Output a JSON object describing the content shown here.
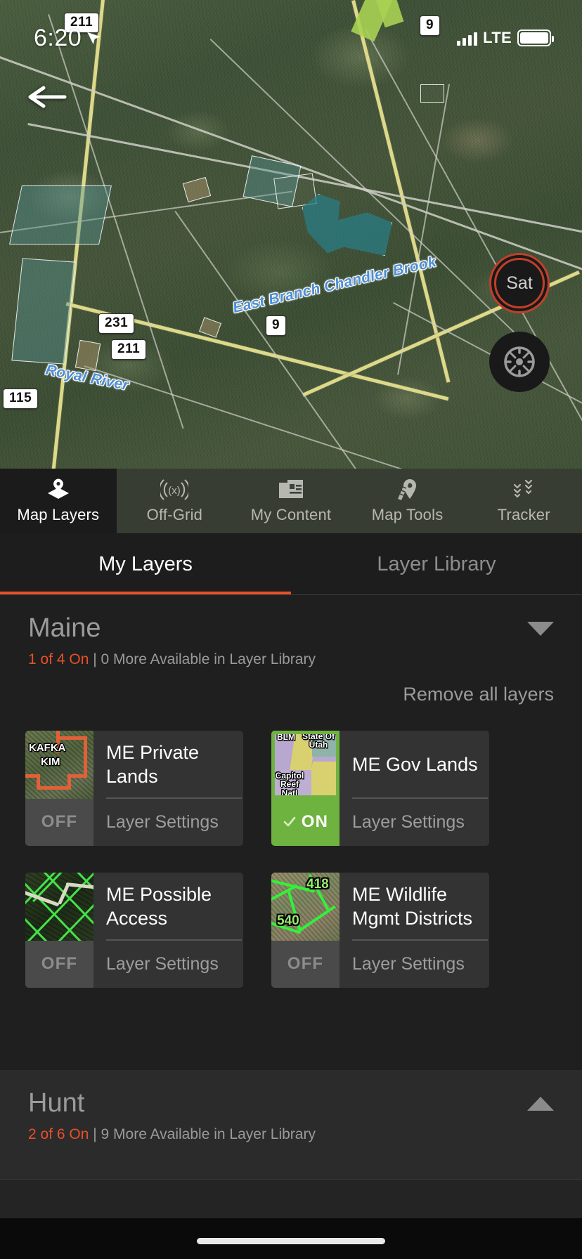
{
  "status_bar": {
    "time": "6:20",
    "location_arrow_icon": "location-arrow-icon",
    "signal_icon": "cellular-bars-icon",
    "network": "LTE",
    "battery_icon": "battery-full-icon"
  },
  "map": {
    "back_icon": "back-arrow-icon",
    "basemap_button_label": "Sat",
    "compass_button_icon": "compass-icon",
    "road_shields": [
      "211",
      "231",
      "211",
      "9",
      "115"
    ],
    "water_labels": [
      "East Branch Chandler Brook",
      "Royal River"
    ]
  },
  "tabbar": {
    "tabs": [
      {
        "label": "Map Layers",
        "icon": "layers-icon",
        "active": true
      },
      {
        "label": "Off-Grid",
        "icon": "broadcast-icon",
        "active": false
      },
      {
        "label": "My Content",
        "icon": "content-list-icon",
        "active": false
      },
      {
        "label": "Map Tools",
        "icon": "ruler-pin-icon",
        "active": false
      },
      {
        "label": "Tracker",
        "icon": "tracks-icon",
        "active": false
      }
    ]
  },
  "subtabs": {
    "tabs": [
      {
        "label": "My Layers",
        "active": true
      },
      {
        "label": "Layer Library",
        "active": false
      }
    ],
    "active_underline_color": "#e8502a"
  },
  "panel": {
    "remove_all_label": "Remove all layers",
    "groups": [
      {
        "title": "Maine",
        "on_count_text": "1 of 4 On",
        "available_text": " | 0 More Available in Layer Library",
        "expanded": true,
        "chevron_icon": "chevron-down-icon",
        "layers": [
          {
            "title": "ME Private Lands",
            "state": "OFF",
            "settings_label": "Layer Settings",
            "thumb_labels": [
              "KAFKA",
              "KIM"
            ],
            "thumb_kind": "private-lands-thumbnail"
          },
          {
            "title": "ME Gov Lands",
            "state": "ON",
            "settings_label": "Layer Settings",
            "thumb_labels": [
              "BLM",
              "State Of Utah",
              "Capitol Reef Natl"
            ],
            "thumb_kind": "gov-lands-thumbnail"
          },
          {
            "title": "ME Possible Access",
            "state": "OFF",
            "settings_label": "Layer Settings",
            "thumb_labels": [],
            "thumb_kind": "possible-access-thumbnail"
          },
          {
            "title": "ME Wildlife Mgmt Districts",
            "state": "OFF",
            "settings_label": "Layer Settings",
            "thumb_labels": [
              "418",
              "540"
            ],
            "thumb_kind": "wildlife-districts-thumbnail"
          }
        ]
      },
      {
        "title": "Hunt",
        "on_count_text": "2 of 6 On",
        "available_text": " | 9 More Available in Layer Library",
        "expanded": false,
        "chevron_icon": "chevron-up-icon",
        "layers": []
      }
    ]
  },
  "colors": {
    "accent_orange": "#e8502a",
    "toggle_on_green": "#6eb33f",
    "panel_bg": "#1f1f1f",
    "card_bg": "#333333"
  }
}
